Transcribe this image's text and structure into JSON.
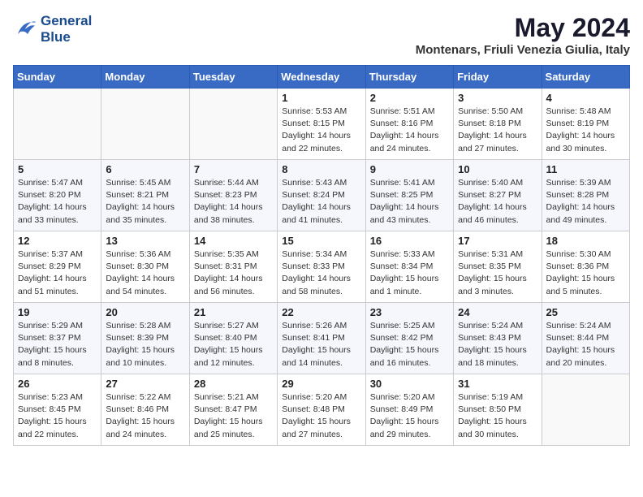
{
  "logo": {
    "line1": "General",
    "line2": "Blue"
  },
  "title": "May 2024",
  "location": "Montenars, Friuli Venezia Giulia, Italy",
  "headers": [
    "Sunday",
    "Monday",
    "Tuesday",
    "Wednesday",
    "Thursday",
    "Friday",
    "Saturday"
  ],
  "weeks": [
    [
      {
        "day": "",
        "info": ""
      },
      {
        "day": "",
        "info": ""
      },
      {
        "day": "",
        "info": ""
      },
      {
        "day": "1",
        "info": "Sunrise: 5:53 AM\nSunset: 8:15 PM\nDaylight: 14 hours\nand 22 minutes."
      },
      {
        "day": "2",
        "info": "Sunrise: 5:51 AM\nSunset: 8:16 PM\nDaylight: 14 hours\nand 24 minutes."
      },
      {
        "day": "3",
        "info": "Sunrise: 5:50 AM\nSunset: 8:18 PM\nDaylight: 14 hours\nand 27 minutes."
      },
      {
        "day": "4",
        "info": "Sunrise: 5:48 AM\nSunset: 8:19 PM\nDaylight: 14 hours\nand 30 minutes."
      }
    ],
    [
      {
        "day": "5",
        "info": "Sunrise: 5:47 AM\nSunset: 8:20 PM\nDaylight: 14 hours\nand 33 minutes."
      },
      {
        "day": "6",
        "info": "Sunrise: 5:45 AM\nSunset: 8:21 PM\nDaylight: 14 hours\nand 35 minutes."
      },
      {
        "day": "7",
        "info": "Sunrise: 5:44 AM\nSunset: 8:23 PM\nDaylight: 14 hours\nand 38 minutes."
      },
      {
        "day": "8",
        "info": "Sunrise: 5:43 AM\nSunset: 8:24 PM\nDaylight: 14 hours\nand 41 minutes."
      },
      {
        "day": "9",
        "info": "Sunrise: 5:41 AM\nSunset: 8:25 PM\nDaylight: 14 hours\nand 43 minutes."
      },
      {
        "day": "10",
        "info": "Sunrise: 5:40 AM\nSunset: 8:27 PM\nDaylight: 14 hours\nand 46 minutes."
      },
      {
        "day": "11",
        "info": "Sunrise: 5:39 AM\nSunset: 8:28 PM\nDaylight: 14 hours\nand 49 minutes."
      }
    ],
    [
      {
        "day": "12",
        "info": "Sunrise: 5:37 AM\nSunset: 8:29 PM\nDaylight: 14 hours\nand 51 minutes."
      },
      {
        "day": "13",
        "info": "Sunrise: 5:36 AM\nSunset: 8:30 PM\nDaylight: 14 hours\nand 54 minutes."
      },
      {
        "day": "14",
        "info": "Sunrise: 5:35 AM\nSunset: 8:31 PM\nDaylight: 14 hours\nand 56 minutes."
      },
      {
        "day": "15",
        "info": "Sunrise: 5:34 AM\nSunset: 8:33 PM\nDaylight: 14 hours\nand 58 minutes."
      },
      {
        "day": "16",
        "info": "Sunrise: 5:33 AM\nSunset: 8:34 PM\nDaylight: 15 hours\nand 1 minute."
      },
      {
        "day": "17",
        "info": "Sunrise: 5:31 AM\nSunset: 8:35 PM\nDaylight: 15 hours\nand 3 minutes."
      },
      {
        "day": "18",
        "info": "Sunrise: 5:30 AM\nSunset: 8:36 PM\nDaylight: 15 hours\nand 5 minutes."
      }
    ],
    [
      {
        "day": "19",
        "info": "Sunrise: 5:29 AM\nSunset: 8:37 PM\nDaylight: 15 hours\nand 8 minutes."
      },
      {
        "day": "20",
        "info": "Sunrise: 5:28 AM\nSunset: 8:39 PM\nDaylight: 15 hours\nand 10 minutes."
      },
      {
        "day": "21",
        "info": "Sunrise: 5:27 AM\nSunset: 8:40 PM\nDaylight: 15 hours\nand 12 minutes."
      },
      {
        "day": "22",
        "info": "Sunrise: 5:26 AM\nSunset: 8:41 PM\nDaylight: 15 hours\nand 14 minutes."
      },
      {
        "day": "23",
        "info": "Sunrise: 5:25 AM\nSunset: 8:42 PM\nDaylight: 15 hours\nand 16 minutes."
      },
      {
        "day": "24",
        "info": "Sunrise: 5:24 AM\nSunset: 8:43 PM\nDaylight: 15 hours\nand 18 minutes."
      },
      {
        "day": "25",
        "info": "Sunrise: 5:24 AM\nSunset: 8:44 PM\nDaylight: 15 hours\nand 20 minutes."
      }
    ],
    [
      {
        "day": "26",
        "info": "Sunrise: 5:23 AM\nSunset: 8:45 PM\nDaylight: 15 hours\nand 22 minutes."
      },
      {
        "day": "27",
        "info": "Sunrise: 5:22 AM\nSunset: 8:46 PM\nDaylight: 15 hours\nand 24 minutes."
      },
      {
        "day": "28",
        "info": "Sunrise: 5:21 AM\nSunset: 8:47 PM\nDaylight: 15 hours\nand 25 minutes."
      },
      {
        "day": "29",
        "info": "Sunrise: 5:20 AM\nSunset: 8:48 PM\nDaylight: 15 hours\nand 27 minutes."
      },
      {
        "day": "30",
        "info": "Sunrise: 5:20 AM\nSunset: 8:49 PM\nDaylight: 15 hours\nand 29 minutes."
      },
      {
        "day": "31",
        "info": "Sunrise: 5:19 AM\nSunset: 8:50 PM\nDaylight: 15 hours\nand 30 minutes."
      },
      {
        "day": "",
        "info": ""
      }
    ]
  ]
}
